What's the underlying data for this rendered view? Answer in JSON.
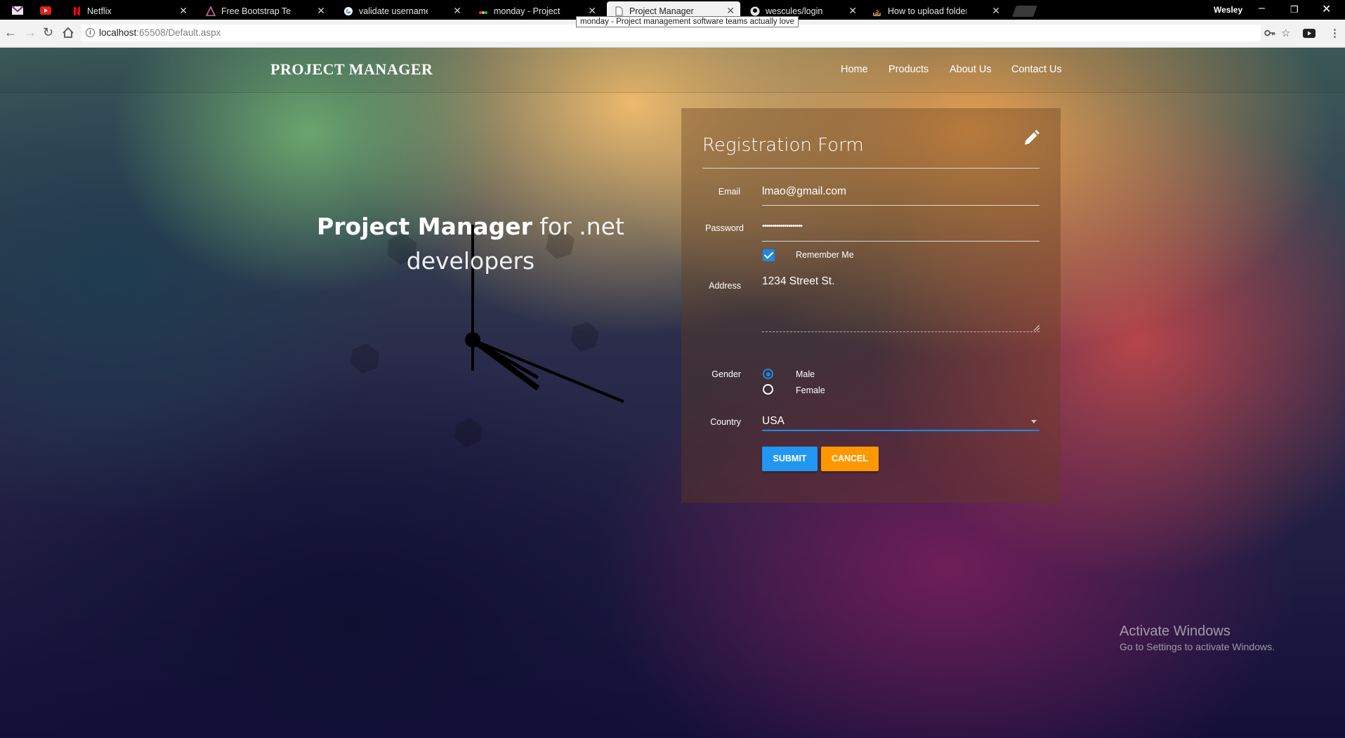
{
  "browser": {
    "tabs": [
      {
        "title": "",
        "icon": "gmail-icon"
      },
      {
        "title": "",
        "icon": "youtube-icon"
      },
      {
        "title": "Netflix",
        "icon": "netflix-icon"
      },
      {
        "title": "Free Bootstrap Template",
        "icon": "bootstrap-template-icon"
      },
      {
        "title": "validate username and p",
        "icon": "google-icon"
      },
      {
        "title": "monday - Project manag",
        "icon": "monday-icon"
      },
      {
        "title": "Project Manager",
        "icon": "page-icon",
        "active": true
      },
      {
        "title": "wescules/login-screen",
        "icon": "github-icon"
      },
      {
        "title": "How to upload folders o",
        "icon": "stackoverflow-icon"
      }
    ],
    "tooltip": "monday - Project management software teams actually love",
    "profile_name": "Wesley",
    "url_host": "localhost",
    "url_path": ":65508/Default.aspx"
  },
  "navbar": {
    "brand": "PROJECT MANAGER",
    "links": [
      "Home",
      "Products",
      "About Us",
      "Contact Us"
    ]
  },
  "hero": {
    "title_strong": "Project Manager",
    "title_rest": "for .net",
    "title_line2": "developers"
  },
  "form": {
    "title": "Registration Form",
    "email_label": "Email",
    "email_value": "lmao@gmail.com",
    "password_label": "Password",
    "password_value": "••••••••••••••••••••",
    "remember_label": "Remember Me",
    "remember_checked": true,
    "address_label": "Address",
    "address_value": "1234 Street St.",
    "gender_label": "Gender",
    "gender_options": [
      "Male",
      "Female"
    ],
    "gender_selected": "Male",
    "country_label": "Country",
    "country_value": "USA",
    "submit_label": "SUBMIT",
    "cancel_label": "CANCEL"
  },
  "watermark": {
    "line1": "Activate Windows",
    "line2": "Go to Settings to activate Windows."
  },
  "colors": {
    "primary": "#2196f3",
    "accent": "#ff9800"
  }
}
